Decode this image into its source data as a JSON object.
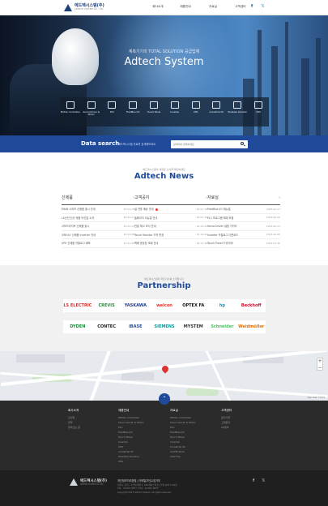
{
  "header": {
    "logo_name": "에드텍시스템(주)",
    "logo_sub": "ADTECH SYSTEM CO., LTD.",
    "nav": [
      "회사소개",
      "제품안내",
      "자료실",
      "고객센터"
    ],
    "social": [
      "f",
      "𝕏"
    ]
  },
  "hero": {
    "subtitle": "계측기기의 TOTAL SOLUTION 공급업체",
    "title": "Adtech System",
    "products": [
      {
        "label": "Motion Controller",
        "icon": "motion-controller-icon"
      },
      {
        "label": "Servo Driver & Motor",
        "icon": "servo-driver-icon"
      },
      {
        "label": "PLC",
        "icon": "plc-icon"
      },
      {
        "label": "FieldBus I/O",
        "icon": "fieldbus-icon"
      },
      {
        "label": "Touch Panel",
        "icon": "touch-panel-icon"
      },
      {
        "label": "Inverter",
        "icon": "inverter-icon"
      },
      {
        "label": "UPS",
        "icon": "ups-icon"
      },
      {
        "label": "Industrial PC",
        "icon": "industrial-pc-icon"
      },
      {
        "label": "Wireless Solution",
        "icon": "wireless-icon"
      },
      {
        "label": "OSS",
        "icon": "oss-icon"
      }
    ]
  },
  "search": {
    "title": "Data search",
    "desc": "에드텍시스템 자료를 검색해보세요",
    "placeholder": "검색어를 입력하세요"
  },
  "news": {
    "kicker": "에드텍시스템의 새로운 소식을 확인하세요",
    "title": "Adtech News",
    "columns": [
      {
        "label": "신제품",
        "more": "›",
        "rows": [
          {
            "text": "MAIN 시리즈 신제품 출시 안내",
            "date": "23.02.28",
            "new": false
          },
          {
            "text": "LS산전 신규 제품 라인업 소개",
            "date": "23.02.21",
            "new": false
          },
          {
            "text": "서보드라이브 신제품 출시",
            "date": "23.02.14",
            "new": false
          },
          {
            "text": "오토닉스 신제품 Inverter 안내",
            "date": "23.02.08",
            "new": false
          },
          {
            "text": "UPS 신제품 카탈로그 배포",
            "date": "23.01.30",
            "new": false
          }
        ]
      },
      {
        "label": "고객공지",
        "more": "›",
        "rows": [
          {
            "text": "설 연휴 배송 안내",
            "date": "23.01.18",
            "new": true
          },
          {
            "text": "홈페이지 리뉴얼 안내",
            "date": "23.01.10",
            "new": false
          },
          {
            "text": "연말 재고 조사 안내",
            "date": "22.12.22",
            "new": false
          },
          {
            "text": "Touch Monitor 가격 변경",
            "date": "22.12.01",
            "new": false
          },
          {
            "text": "택배 운송장 조회 안내",
            "date": "22.11.28",
            "new": false
          }
        ]
      },
      {
        "label": "자료실",
        "more": "›",
        "rows": [
          {
            "text": "FieldBus I/O 매뉴얼",
            "date": "2023.02.27",
            "new": false
          },
          {
            "text": "PLC 프로그램 예제 모음",
            "date": "2023.02.20",
            "new": false
          },
          {
            "text": "Servo Driver 설정 가이드",
            "date": "2023.02.13",
            "new": false
          },
          {
            "text": "Inverter 카탈로그 다운로드",
            "date": "2023.02.06",
            "new": false
          },
          {
            "text": "Touch Panel 드라이버",
            "date": "2023.01.30",
            "new": false
          }
        ]
      }
    ]
  },
  "partnership": {
    "kicker": "에드텍시스템의 파트너사를 소개합니다",
    "title": "Partnership",
    "row1": [
      {
        "name": "LS ELECTRIC",
        "color": "#d0302b"
      },
      {
        "name": "CREVIS",
        "color": "#2a8a3e"
      },
      {
        "name": "YASKAWA",
        "color": "#1d3f8f"
      },
      {
        "name": "welcon",
        "color": "#e4322b"
      },
      {
        "name": "OPTEX FA",
        "color": "#111111"
      },
      {
        "name": "hp",
        "color": "#0096d6"
      },
      {
        "name": "Beckhoff",
        "color": "#c8102e"
      }
    ],
    "row2": [
      {
        "name": "DYDEN",
        "color": "#1c8a3a"
      },
      {
        "name": "CONTEC",
        "color": "#222222"
      },
      {
        "name": "iBASE",
        "color": "#1d4fa0"
      },
      {
        "name": "SIEMENS",
        "color": "#009999"
      },
      {
        "name": "MYSTEM",
        "color": "#333333"
      },
      {
        "name": "Schneider",
        "color": "#3dcd58"
      },
      {
        "name": "Weidmüller",
        "color": "#e17000"
      }
    ]
  },
  "map": {
    "credit": "Map data ©2023"
  },
  "footer": {
    "columns": [
      {
        "head": "회사소개",
        "items": [
          "인사말",
          "연혁",
          "찾아오는 길"
        ]
      },
      {
        "head": "제품안내",
        "items": [
          "Motion Controller",
          "Servo Driver & Motor",
          "PLC",
          "FieldBus I/O",
          "Touch Panel",
          "Inverter",
          "UPS",
          "Industrial PC",
          "Wireless Solution",
          "OSS"
        ]
      },
      {
        "head": "자료실",
        "items": [
          "Motion Controller",
          "Servo Driver & Motor",
          "PLC",
          "FieldBus I/O",
          "Touch Panel",
          "Inverter",
          "Industrial PC",
          "Certification",
          "CAD File"
        ]
      },
      {
        "head": "고객센터",
        "items": [
          "공지사항",
          "고객문의",
          "AS문의"
        ]
      }
    ],
    "links": "개인정보처리방침 | 이메일무단수집거부",
    "info": [
      "서울시 금천구 가산디지털1로 196 에이스테크노타워 10차 1116호",
      "TEL : 02-857-9877 | FAX : 02-857-9875",
      "Copyright 2023 Adtech System. All rights reserved."
    ],
    "logo_name": "에드텍시스템(주)",
    "logo_sub": "ADTECH SYSTEM CO., LTD.",
    "social": [
      "f",
      "𝕏"
    ],
    "top_label": "⌃"
  }
}
